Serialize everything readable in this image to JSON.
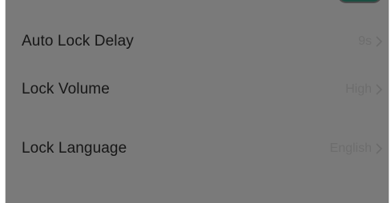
{
  "settings": {
    "rows": [
      {
        "label": "Auto Lock Delay",
        "value": "9s"
      },
      {
        "label": "Lock Volume",
        "value": "High"
      },
      {
        "label": "Lock Language",
        "value": "English"
      }
    ],
    "toggle": {
      "state": "on"
    }
  },
  "colors": {
    "overlay": "#7a7a7a",
    "toggle_on": "#1b4e41",
    "label_text": "#161616",
    "value_text": "#6d6d6d"
  }
}
